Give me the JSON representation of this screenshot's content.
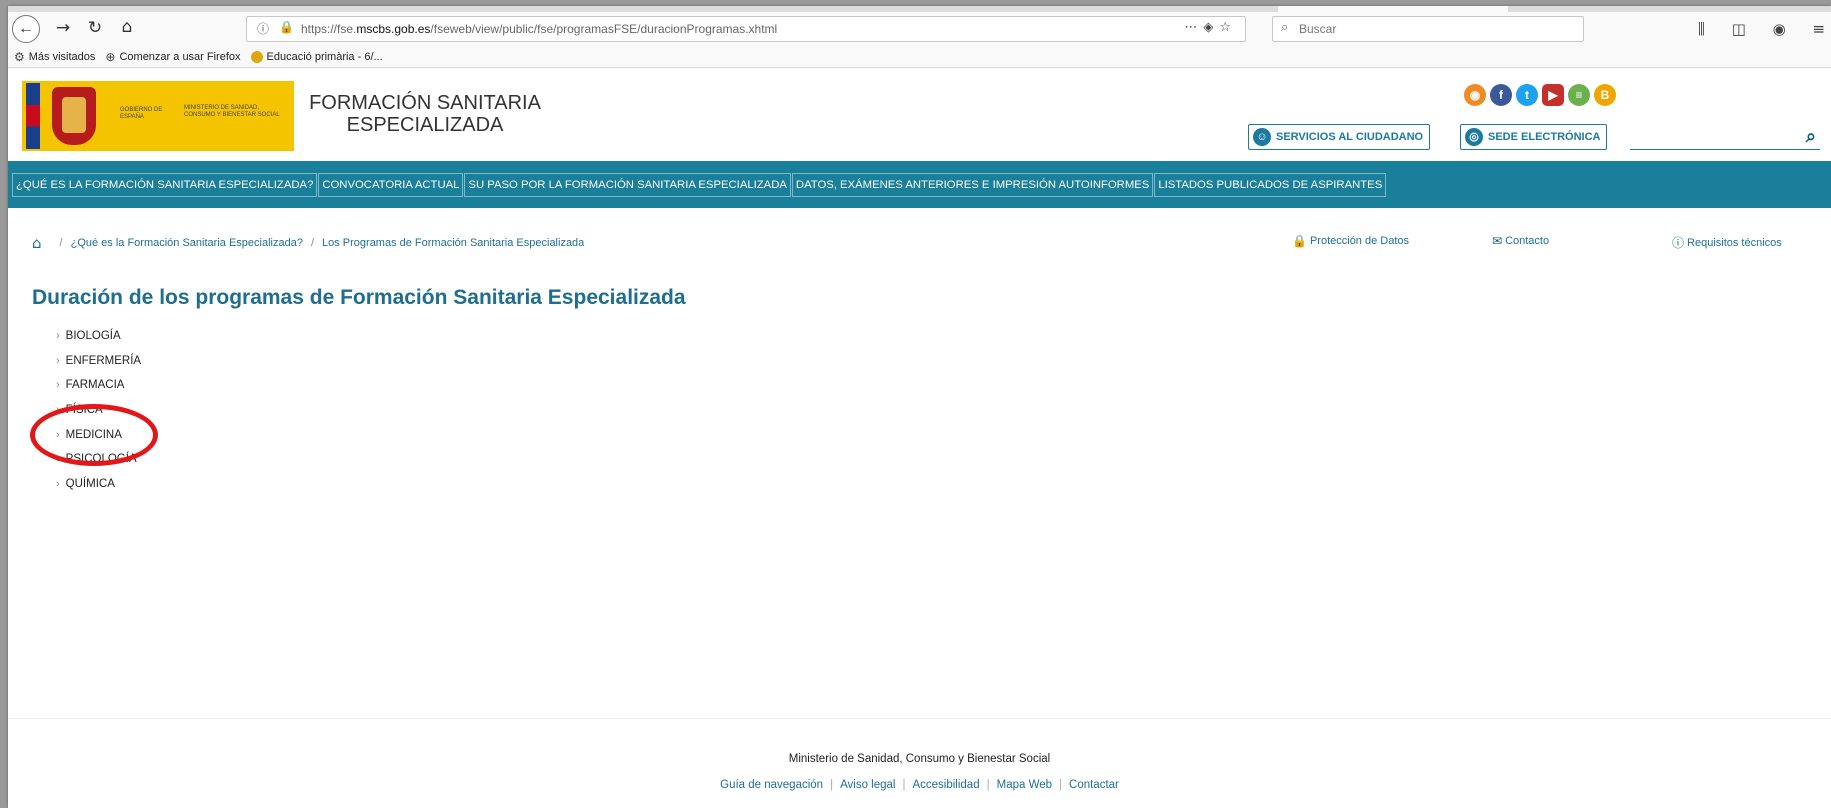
{
  "browser": {
    "url": "https://fse.mscbs.gob.es/fseweb/view/public/fse/programasFSE/duracionProgramas.xhtml",
    "url_prefix": "https://fse.",
    "url_domain": "mscbs.gob.es",
    "url_path": "/fseweb/view/public/fse/programasFSE/duracionProgramas.xhtml",
    "search_placeholder": "Buscar",
    "bookmarks": [
      {
        "label": "Más visitados",
        "icon": "gear-icon"
      },
      {
        "label": "Comenzar a usar Firefox",
        "icon": "firefox-icon"
      },
      {
        "label": "Educació primària - 6/...",
        "icon": "site-icon"
      }
    ]
  },
  "header": {
    "gov_line1": "GOBIERNO DE ESPAÑA",
    "gov_line2": "MINISTERIO DE SANIDAD, CONSUMO Y BIENESTAR SOCIAL",
    "site_title": "FORMACIÓN SANITARIA ESPECIALIZADA",
    "services_label": "SERVICIOS AL CIUDADANO",
    "sede_label": "SEDE ELECTRÓNICA",
    "social": [
      {
        "name": "rss-icon",
        "color": "#f08a24",
        "glyph": "◉"
      },
      {
        "name": "facebook-icon",
        "color": "#3b5998",
        "glyph": "f"
      },
      {
        "name": "twitter-icon",
        "color": "#1da1f2",
        "glyph": "t"
      },
      {
        "name": "youtube-icon",
        "color": "#c4302b",
        "glyph": "▶"
      },
      {
        "name": "list-icon",
        "color": "#6ab04c",
        "glyph": "≡"
      },
      {
        "name": "blog-icon",
        "color": "#f0a500",
        "glyph": "B"
      }
    ]
  },
  "nav": [
    "¿Qué es la Formación Sanitaria Especializada?",
    "Convocatoria actual",
    "Su paso por la Formación Sanitaria Especializada",
    "Datos, exámenes anteriores e impresión autoinformes",
    "Listados publicados de aspirantes"
  ],
  "breadcrumb": {
    "items": [
      "¿Qué es la Formación Sanitaria Especializada?",
      "Los Programas de Formación Sanitaria Especializada"
    ]
  },
  "utility_links": {
    "privacy": "Protección de Datos",
    "contact": "Contacto",
    "requirements": "Requisitos técnicos"
  },
  "main": {
    "title": "Duración de los programas de Formación Sanitaria Especializada",
    "specialties": [
      "BIOLOGÍA",
      "ENFERMERÍA",
      "FARMACIA",
      "FÍSICA",
      "MEDICINA",
      "PSICOLOGÍA",
      "QUÍMICA"
    ],
    "highlighted": "MEDICINA",
    "highlight_color": "#e01818"
  },
  "footer": {
    "org": "Ministerio de Sanidad, Consumo y Bienestar Social",
    "links": [
      "Guía de navegación",
      "Aviso legal",
      "Accesibilidad",
      "Mapa Web",
      "Contactar"
    ]
  },
  "colors": {
    "nav_bg": "#1a7f9a",
    "link": "#1d6f95",
    "title": "#1f6e8f",
    "gov_yellow": "#f4c400"
  }
}
